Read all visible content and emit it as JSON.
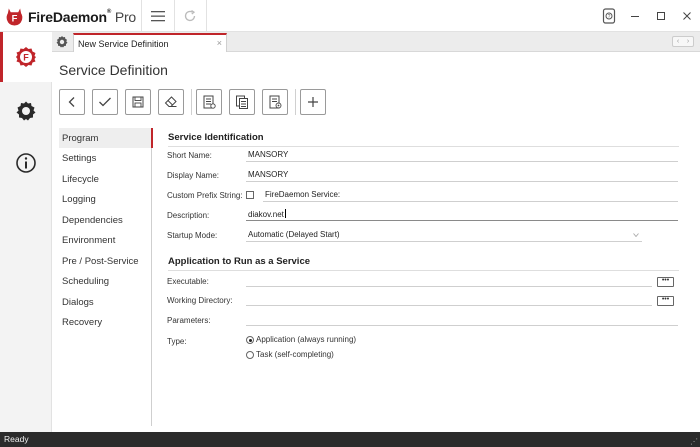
{
  "app": {
    "brand": "FireDaemon",
    "brand_suffix": "Pro",
    "trademark": "®"
  },
  "titlebar": {
    "menu_icon": "hamburger-menu-icon",
    "refresh_icon": "refresh-icon",
    "help_icon": "help-icon"
  },
  "tabs": [
    {
      "label": "New Service Definition",
      "close": "×"
    }
  ],
  "page": {
    "title": "Service Definition"
  },
  "toolbar": {
    "buttons": [
      "back-icon",
      "check-icon",
      "save-icon",
      "eraser-icon",
      "document-list-icon",
      "copy-document-icon",
      "document-settings-icon",
      "plus-icon"
    ]
  },
  "nav": {
    "items": [
      {
        "label": "Program",
        "active": true
      },
      {
        "label": "Settings"
      },
      {
        "label": "Lifecycle"
      },
      {
        "label": "Logging"
      },
      {
        "label": "Dependencies"
      },
      {
        "label": "Environment"
      },
      {
        "label": "Pre / Post-Service"
      },
      {
        "label": "Scheduling"
      },
      {
        "label": "Dialogs"
      },
      {
        "label": "Recovery"
      }
    ]
  },
  "form": {
    "identification": {
      "title": "Service Identification",
      "short_name_label": "Short Name:",
      "short_name_value": "MANSORY",
      "display_name_label": "Display Name:",
      "display_name_value": "MANSORY",
      "prefix_label": "Custom Prefix String:",
      "prefix_checked": false,
      "prefix_value": "FireDaemon Service:",
      "description_label": "Description:",
      "description_value": "diakov.net",
      "startup_label": "Startup Mode:",
      "startup_value": "Automatic (Delayed Start)"
    },
    "application": {
      "title": "Application to Run as a Service",
      "executable_label": "Executable:",
      "executable_value": "",
      "working_dir_label": "Working Directory:",
      "working_dir_value": "",
      "parameters_label": "Parameters:",
      "parameters_value": "",
      "type_label": "Type:",
      "type_options": [
        {
          "label": "Application (always running)",
          "selected": true
        },
        {
          "label": "Task (self-completing)",
          "selected": false
        }
      ],
      "browse_label": "•••"
    }
  },
  "status": {
    "text": "Ready"
  },
  "colors": {
    "accent": "#c0252a",
    "status_bar": "#2b2b2b"
  }
}
